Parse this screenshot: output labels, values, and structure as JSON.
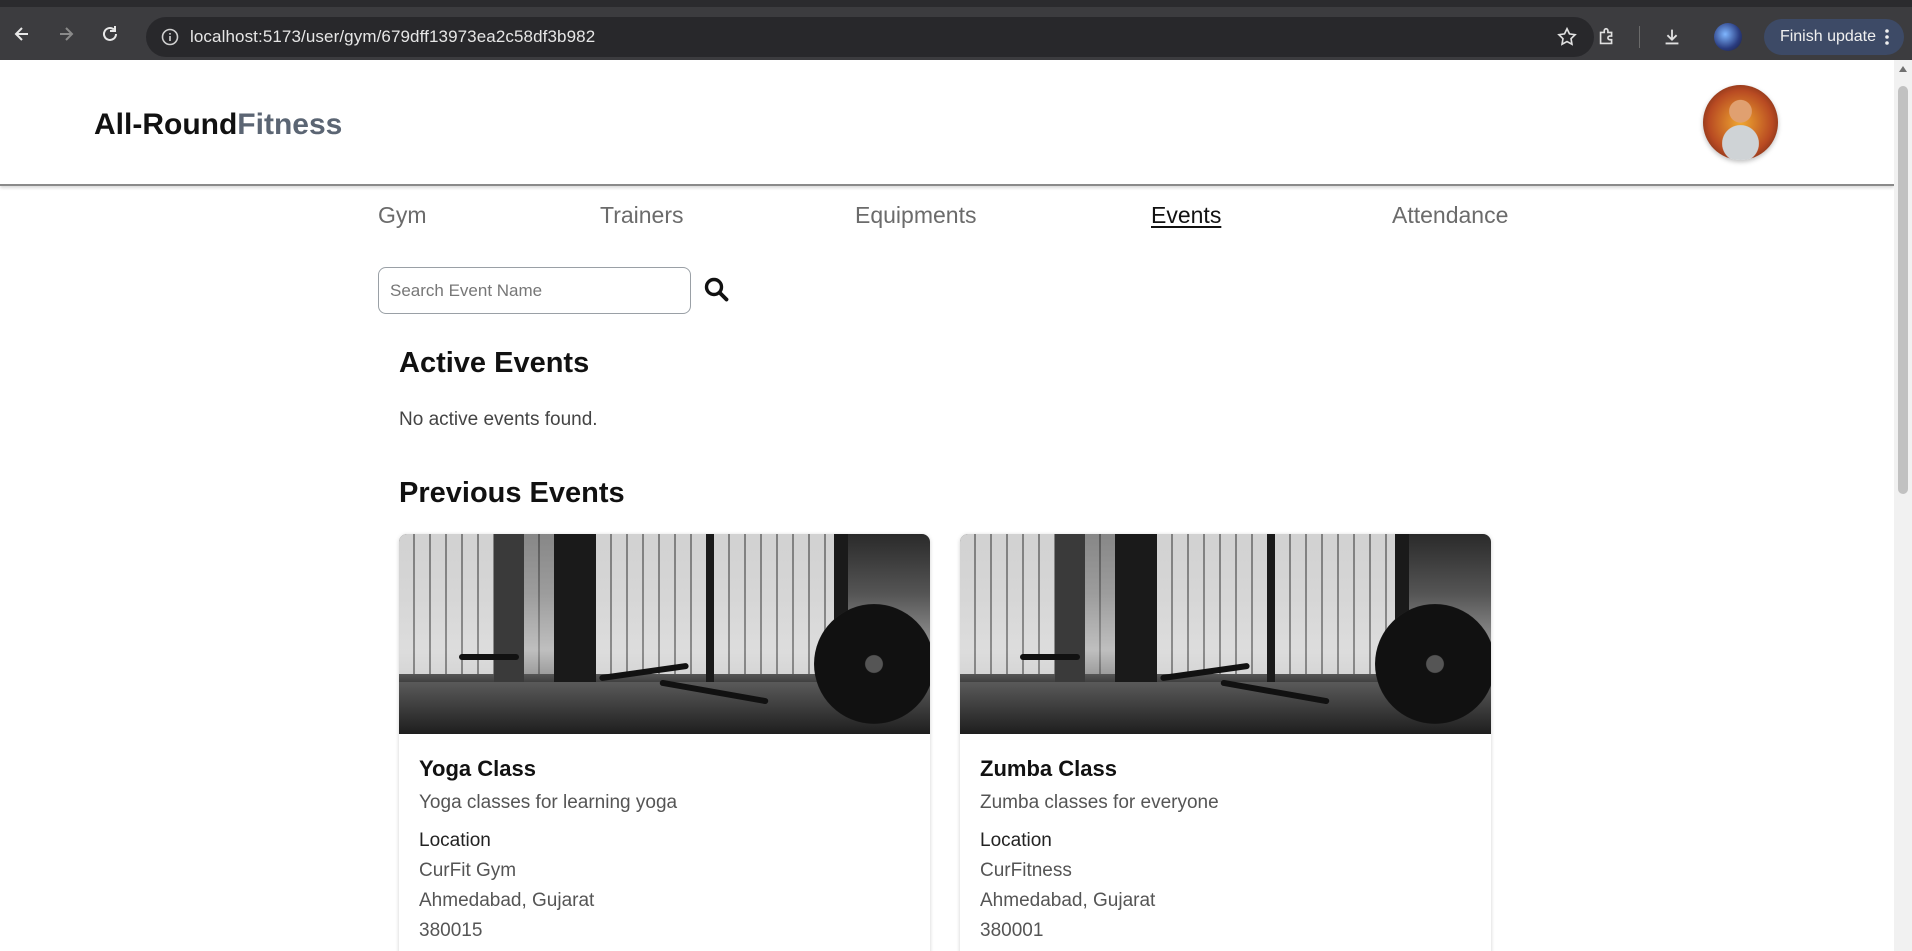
{
  "browser": {
    "url_host": "localhost",
    "url_rest": ":5173/user/gym/679dff13973ea2c58df3b982",
    "finish_update_label": "Finish update"
  },
  "header": {
    "logo_main": "All-Round",
    "logo_accent": "Fitness"
  },
  "nav": {
    "tabs": [
      {
        "label": "Gym",
        "active": false
      },
      {
        "label": "Trainers",
        "active": false
      },
      {
        "label": "Equipments",
        "active": false
      },
      {
        "label": "Events",
        "active": true
      },
      {
        "label": "Attendance",
        "active": false
      }
    ]
  },
  "search": {
    "placeholder": "Search Event Name",
    "value": ""
  },
  "active_events": {
    "title": "Active Events",
    "empty_message": "No active events found."
  },
  "previous_events": {
    "title": "Previous Events",
    "cards": [
      {
        "title": "Yoga Class",
        "description": "Yoga classes for learning yoga",
        "location_label": "Location",
        "location_name": "CurFit Gym",
        "city": "Ahmedabad, Gujarat",
        "pincode": "380015"
      },
      {
        "title": "Zumba Class",
        "description": "Zumba classes for everyone",
        "location_label": "Location",
        "location_name": "CurFitness",
        "city": "Ahmedabad, Gujarat",
        "pincode": "380001"
      }
    ]
  },
  "colors": {
    "logo_accent": "#5b6573",
    "active_tab": "#111111",
    "inactive_tab": "#6b6b6b",
    "chrome_bg": "#3c3c3f"
  }
}
